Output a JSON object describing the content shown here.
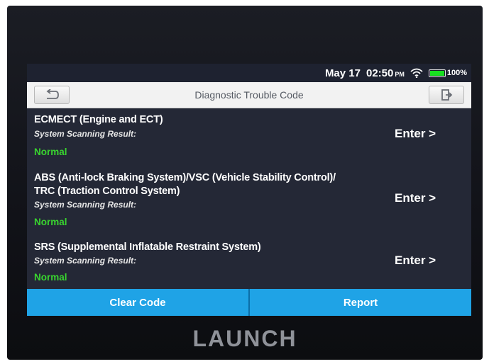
{
  "status_bar": {
    "date": "May 17",
    "time": "02:50",
    "ampm": "PM",
    "battery": "100%"
  },
  "title_bar": {
    "title": "Diagnostic Trouble Code"
  },
  "systems": [
    {
      "name_lines": [
        "ECMECT (Engine and ECT)"
      ],
      "scan_label": "System Scanning Result:",
      "status": "Normal",
      "action": "Enter >"
    },
    {
      "name_lines": [
        "ABS (Anti-lock Braking System)/VSC (Vehicle Stability Control)/",
        "TRC (Traction Control System)"
      ],
      "scan_label": "System Scanning Result:",
      "status": "Normal",
      "action": "Enter >"
    },
    {
      "name_lines": [
        "SRS (Supplemental Inflatable Restraint System)"
      ],
      "scan_label": "System Scanning Result:",
      "status": "Normal",
      "action": "Enter >"
    }
  ],
  "bottom_bar": {
    "clear_code": "Clear Code",
    "report": "Report"
  },
  "device": {
    "brand": "LAUNCH"
  },
  "colors": {
    "accent": "#1fa3e6",
    "status_normal": "#39d52f",
    "screen_bg": "#242836"
  },
  "icons": {
    "back": "back-arrow-icon",
    "exit": "exit-icon",
    "wifi": "wifi-icon",
    "battery": "battery-icon"
  }
}
